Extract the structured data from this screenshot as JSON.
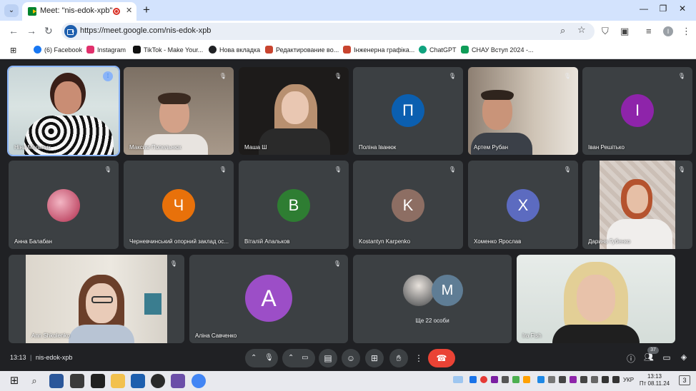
{
  "browser": {
    "tab_title": "Meet: \"nis-edok-xpb\"",
    "tab_menu_icon": "chevron-down-icon",
    "url": "https://meet.google.com/nis-edok-xpb",
    "profile_initial": "I",
    "bookmarks": [
      {
        "label": "(6) Facebook",
        "color": "#1877f2"
      },
      {
        "label": "Instagram",
        "color": "#e1306c"
      },
      {
        "label": "TikTok - Make Your...",
        "color": "#111111"
      },
      {
        "label": "Нова вкладка",
        "color": "#202124"
      },
      {
        "label": "Редактирование во...",
        "color": "#c8442f"
      },
      {
        "label": "Інженерна графіка...",
        "color": "#c8442f"
      },
      {
        "label": "ChatGPT",
        "color": "#10a37f"
      },
      {
        "label": "СНАУ Вступ 2024 -...",
        "color": "#0f9d58"
      }
    ]
  },
  "meet": {
    "participants": [
      {
        "name": "Ніна Мельник",
        "avatar_letter": "",
        "avatar_color": "",
        "speaking": true
      },
      {
        "name": "Максим Попельнюх",
        "avatar_letter": "",
        "avatar_color": "",
        "speaking": false
      },
      {
        "name": "Маша Ш",
        "avatar_letter": "",
        "avatar_color": "",
        "speaking": false
      },
      {
        "name": "Поліна Іванюк",
        "avatar_letter": "П",
        "avatar_color": "#0b5fb0",
        "speaking": false
      },
      {
        "name": "Артем Рубан",
        "avatar_letter": "",
        "avatar_color": "",
        "speaking": false
      },
      {
        "name": "Іван Решітько",
        "avatar_letter": "І",
        "avatar_color": "#8e24aa",
        "speaking": false
      },
      {
        "name": "Анна Балабан",
        "avatar_letter": "",
        "avatar_color": "",
        "speaking": false
      },
      {
        "name": "Черневчинський опорний заклад ос...",
        "avatar_letter": "Ч",
        "avatar_color": "#e8710a",
        "speaking": false
      },
      {
        "name": "Віталій Апальков",
        "avatar_letter": "В",
        "avatar_color": "#2e7d32",
        "speaking": false
      },
      {
        "name": "Kostantyn Karpenko",
        "avatar_letter": "K",
        "avatar_color": "#8d6e63",
        "speaking": false
      },
      {
        "name": "Хоменко Ярослав",
        "avatar_letter": "Х",
        "avatar_color": "#5c6bc0",
        "speaking": false
      },
      {
        "name": "Дарина Губенко",
        "avatar_letter": "",
        "avatar_color": "",
        "speaking": false
      },
      {
        "name": "Ann Shkolenko",
        "avatar_letter": "",
        "avatar_color": "",
        "speaking": false
      },
      {
        "name": "Аліна Савченко",
        "avatar_letter": "А",
        "avatar_color": "#9c4ec7",
        "speaking": false
      },
      {
        "name": "Ira Fish",
        "avatar_letter": "",
        "avatar_color": "",
        "speaking": false
      }
    ],
    "others": {
      "label": "Ще 22 особи",
      "avatar_letter": "М",
      "avatar_color": "#5f7d95"
    },
    "time": "13:13",
    "separator": "|",
    "meeting_code": "nis-edok-xpb",
    "people_count": "37"
  },
  "taskbar": {
    "lang": "УКР",
    "clock_time": "13:13",
    "clock_date": "Пт 08.11.24",
    "notifications": "3"
  }
}
